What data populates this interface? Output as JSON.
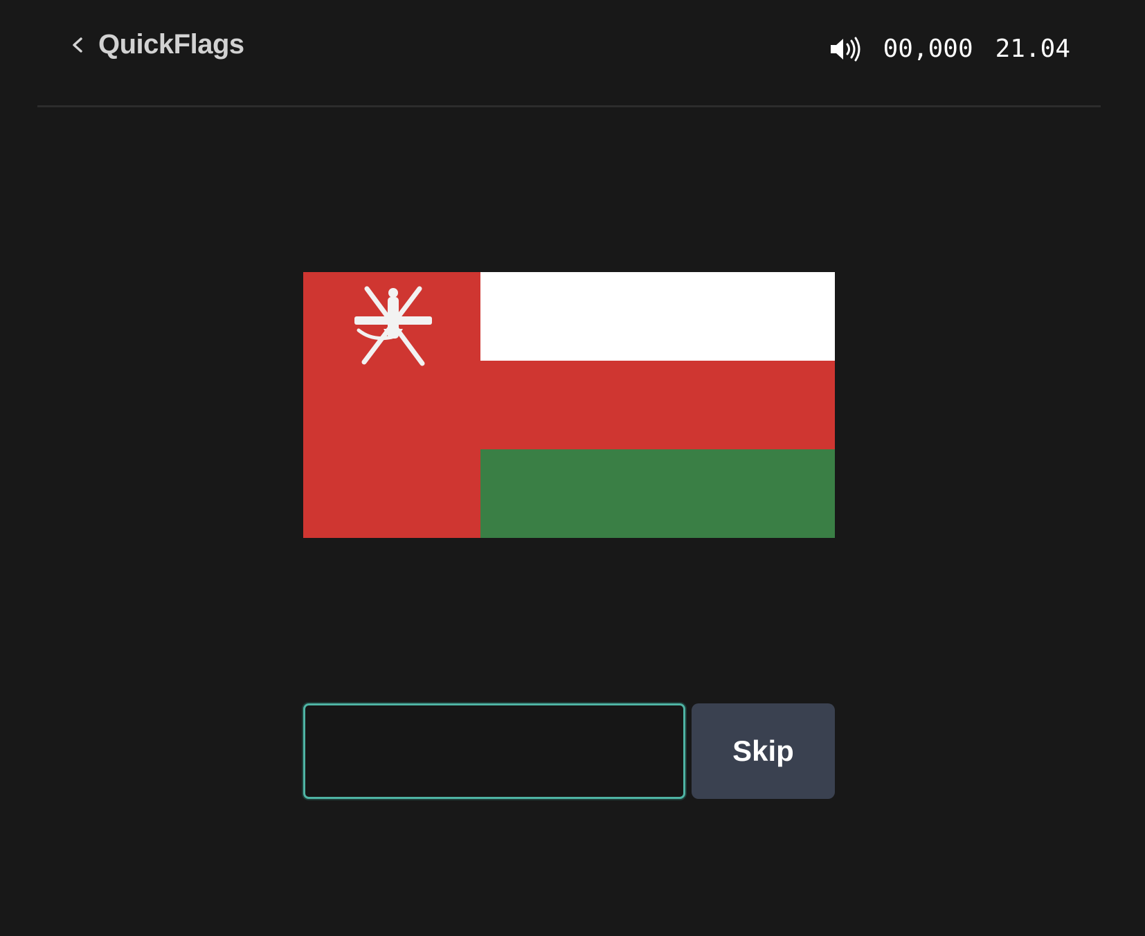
{
  "header": {
    "title": "QuickFlags",
    "back_icon": "chevron-left-icon",
    "sound_icon": "speaker-volume-icon",
    "score": "00,000",
    "timer": "21.04"
  },
  "quiz": {
    "flag": {
      "country_colors": {
        "red": "#cf3631",
        "white": "#ffffff",
        "green": "#3a7f45"
      }
    },
    "answer_input": {
      "value": "",
      "placeholder": ""
    },
    "skip_label": "Skip"
  },
  "theme": {
    "background": "#181818",
    "accent": "#4fb4a4",
    "button_bg": "#3a4150"
  }
}
